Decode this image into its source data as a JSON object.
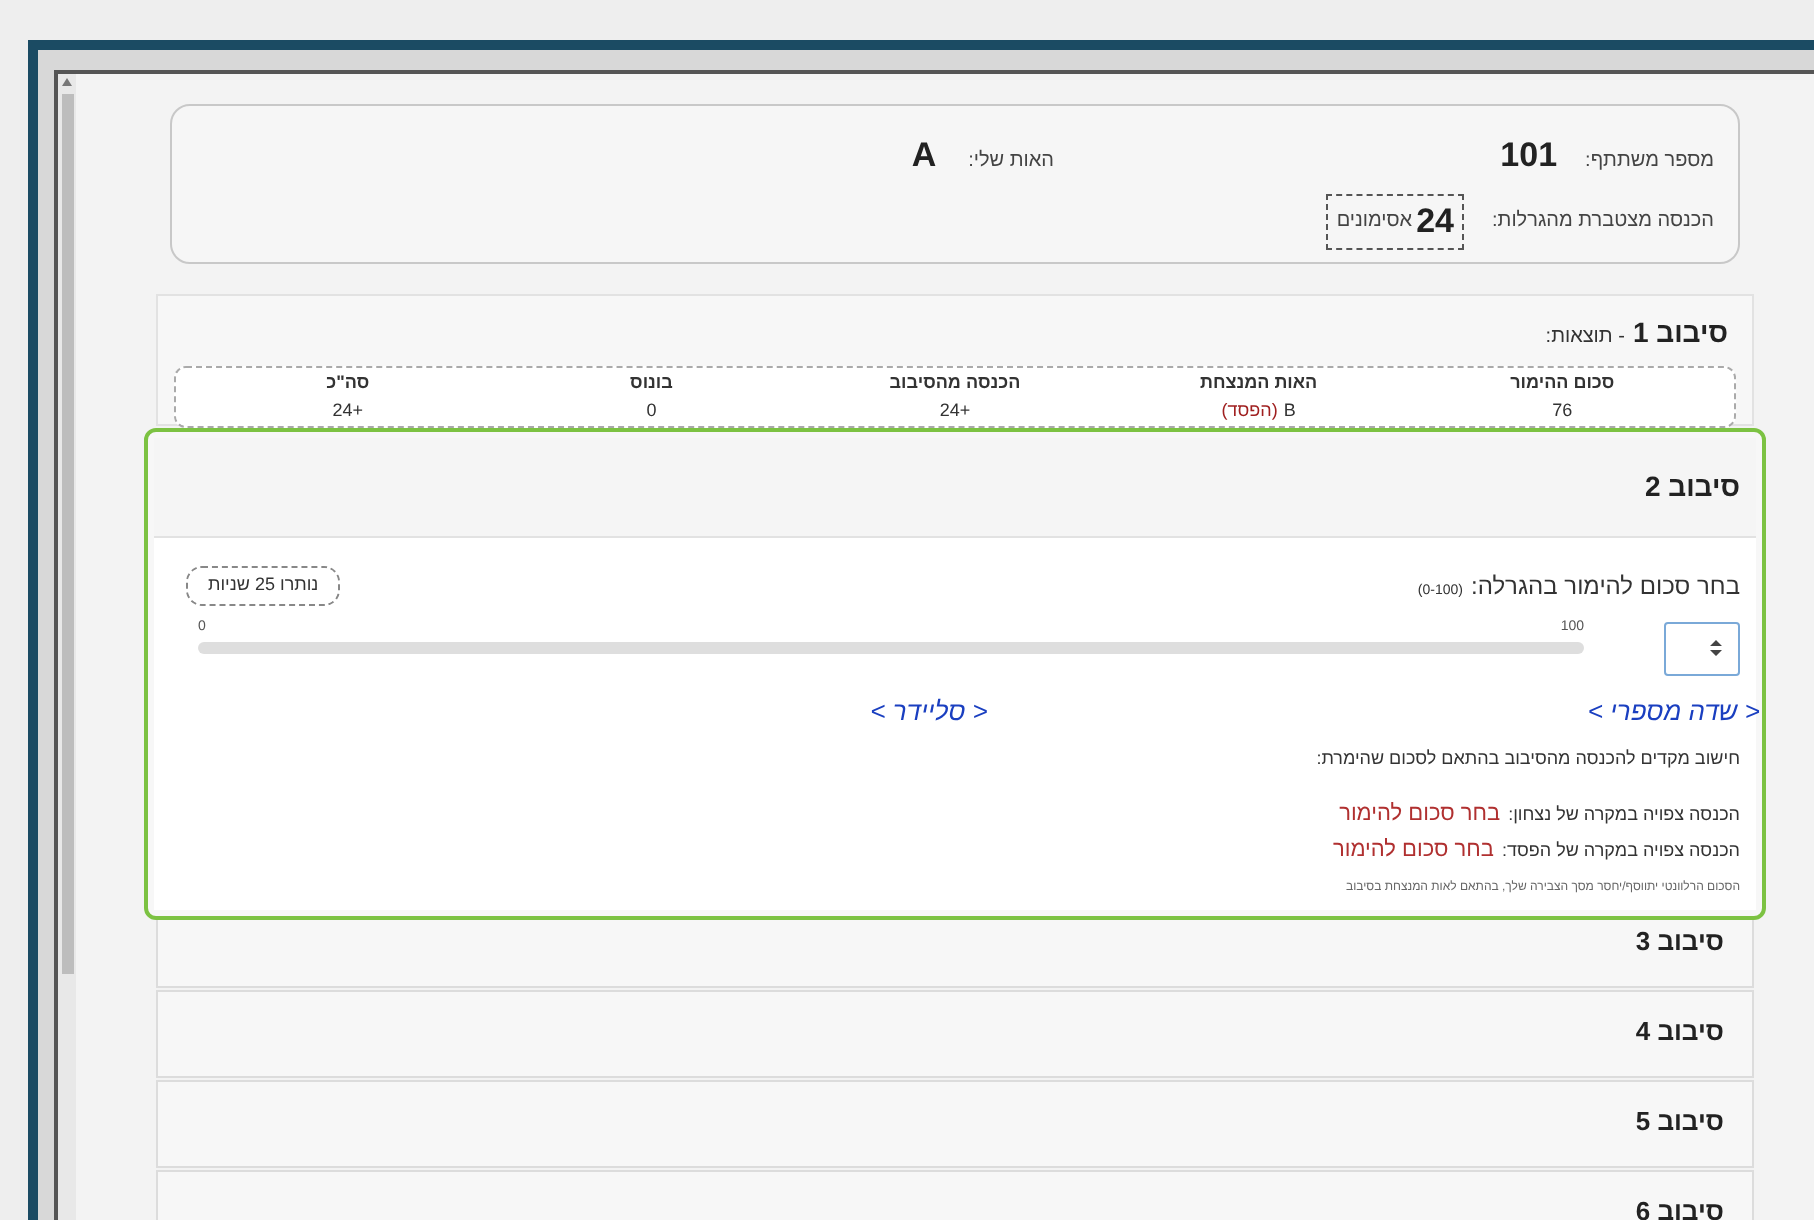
{
  "header": {
    "participant_label": "מספר משתתף:",
    "participant_number": "101",
    "letter_label": "האות שלי:",
    "letter": "A",
    "income_label": "הכנסה מצטברת מהגרלות:",
    "income_value": "24",
    "income_unit": "אסימונים"
  },
  "rounds": [
    {
      "kind": "results",
      "title": "סיבוב 1",
      "subtitle": "- תוצאות:",
      "columns": [
        "סכום ההימור",
        "האות המנצחת",
        "הכנסה מהסיבוב",
        "בונוס",
        "סה\"כ"
      ],
      "row": [
        "76",
        "B",
        "+24",
        "0",
        "+24"
      ],
      "loss_tag": "(הפסד)"
    },
    {
      "kind": "active",
      "title": "סיבוב 2",
      "highlighted": true,
      "prompt": "בחר סכום להימור בהגרלה:",
      "range": "(0-100)",
      "timer": "נותרו 25 שניות",
      "slider_max": "100",
      "slider_min": "0",
      "calc_title": "חישוב מקדים להכנסה מהסיבוב בהתאם לסכום שהימרת:",
      "win_label": "הכנסה צפויה במקרה של נצחון:",
      "win_value": "בחר סכום להימור",
      "loss_label": "הכנסה צפויה במקרה של הפסד:",
      "loss_value": "בחר סכום להימור",
      "note": "הסכום הרלוונטי יתווסף/יחסר מסך הצבירה שלך, בהתאם לאות המנצחת בסיבוב"
    },
    {
      "kind": "collapsed",
      "title": "סיבוב 3"
    },
    {
      "kind": "collapsed",
      "title": "סיבוב 4"
    },
    {
      "kind": "collapsed",
      "title": "סיבוב 5"
    },
    {
      "kind": "collapsed",
      "title": "סיבוב 6"
    }
  ],
  "annotations": [
    "< שדה מספרי >",
    "< סליידר >"
  ]
}
